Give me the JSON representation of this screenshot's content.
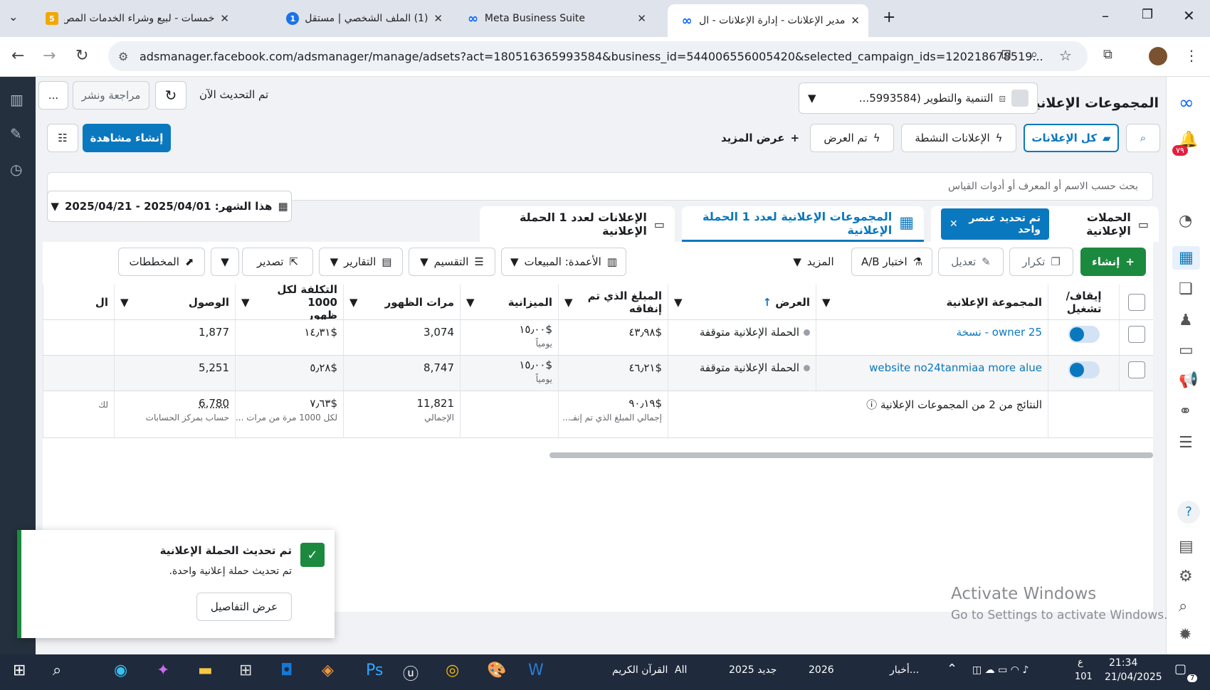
{
  "browser": {
    "tabs": [
      {
        "title": "خمسات - لبيع وشراء الخدمات المص",
        "fav": "5",
        "fav_color": "#f3a800"
      },
      {
        "title": "(1) الملف الشخصي | مستقل",
        "fav": "1",
        "fav_color": "#1a73e8"
      },
      {
        "title": "Meta Business Suite",
        "fav": "∞",
        "fav_color": "#0866ff"
      },
      {
        "title": "مدير الإعلانات - إدارة الإعلانات - ال",
        "fav": "∞",
        "fav_color": "#0866ff"
      }
    ],
    "url": "adsmanager.facebook.com/adsmanager/manage/adsets?act=180516365993584&business_id=544006556005420&selected_campaign_ids=120218678519..."
  },
  "header": {
    "title": "المجموعات الإعلانية",
    "account": "التنمية والتطوير (5993584...",
    "updated": "تم التحديث الآن",
    "review": "مراجعة ونشر",
    "more": "..."
  },
  "filters": {
    "all_ads": "كل الإعلانات",
    "active_ads": "الإعلانات النشطة",
    "delivered": "تم العرض",
    "show_more": "عرض المزيد",
    "create_view": "إنشاء مشاهدة",
    "search_placeholder": "بحث حسب الاسم أو المعرف أو أدوات القياس"
  },
  "levels": {
    "campaigns": "الحملات الإعلانية",
    "selected_pill": "تم تحديد عنصر واحد",
    "adsets": "المجموعات الإعلانية لعدد 1 الحملة الإعلانية",
    "ads": "الإعلانات لعدد 1 الحملة الإعلانية",
    "date": "هذا الشهر: 2025/04/01 - 2025/04/21"
  },
  "actions": {
    "create": "إنشاء",
    "duplicate": "تكرار",
    "edit": "تعديل",
    "ab": "اختبار A/B",
    "more": "المزيد",
    "columns": "الأعمدة: المبيعات",
    "breakdown": "التقسيم",
    "reports": "التقارير",
    "export": "تصدير",
    "charts": "المخططات"
  },
  "table": {
    "headers": {
      "toggle": "إيقاف/\nتشغيل",
      "name": "المجموعة الإعلانية",
      "delivery": "العرض",
      "spent": "المبلغ الذي تم\nإنفاقه",
      "budget": "الميزانية",
      "impressions": "مرات الظهور",
      "cpm": "التكلفة لكل 1000\nظهور",
      "reach": "الوصول",
      "extra": "ال"
    },
    "rows": [
      {
        "name": "owner 25 - نسخة",
        "delivery": "الحملة الإعلانية متوقفة",
        "spent": "$٤٣٫٩٨",
        "budget": "$١٥٫٠٠",
        "budget_sub": "يومياً",
        "impressions": "3,074",
        "cpm": "$١٤٫٣١",
        "reach": "1,877"
      },
      {
        "name": "website no24tanmiaa more alue",
        "delivery": "الحملة الإعلانية متوقفة",
        "spent": "$٤٦٫٢١",
        "budget": "$١٥٫٠٠",
        "budget_sub": "يومياً",
        "impressions": "8,747",
        "cpm": "$٥٫٢٨",
        "reach": "5,251"
      }
    ],
    "totals": {
      "label": "النتائج من 2 من المجموعات الإعلانية",
      "spent": "$٩٠٫١٩",
      "spent_sub": "إجمالي المبلغ الذي تم إنفـ...",
      "impressions": "11,821",
      "impressions_sub": "الإجمالي",
      "cpm": "$٧٫٦٣",
      "cpm_sub": "لكل 1000 مرة من مرات ...",
      "reach": "6,780",
      "reach_sub": "حساب بمركز الحسابات",
      "extra_sub": "لك"
    }
  },
  "toast": {
    "title": "تم تحديث الحملة الإعلانية",
    "body": "تم تحديث حملة إعلانية واحدة.",
    "button": "عرض التفاصيل"
  },
  "watermark": {
    "line1": "Activate Windows",
    "line2": "Go to Settings to activate Windows."
  },
  "rightbar": {
    "badge": "٧٩"
  },
  "taskbar": {
    "items": [
      "أخبار...",
      "2026",
      "جديد 2025",
      "All",
      "القرآن الكريم"
    ],
    "time": "21:34",
    "date": "21/04/2025",
    "lang": "ع",
    "num": "101",
    "notif": "7"
  }
}
